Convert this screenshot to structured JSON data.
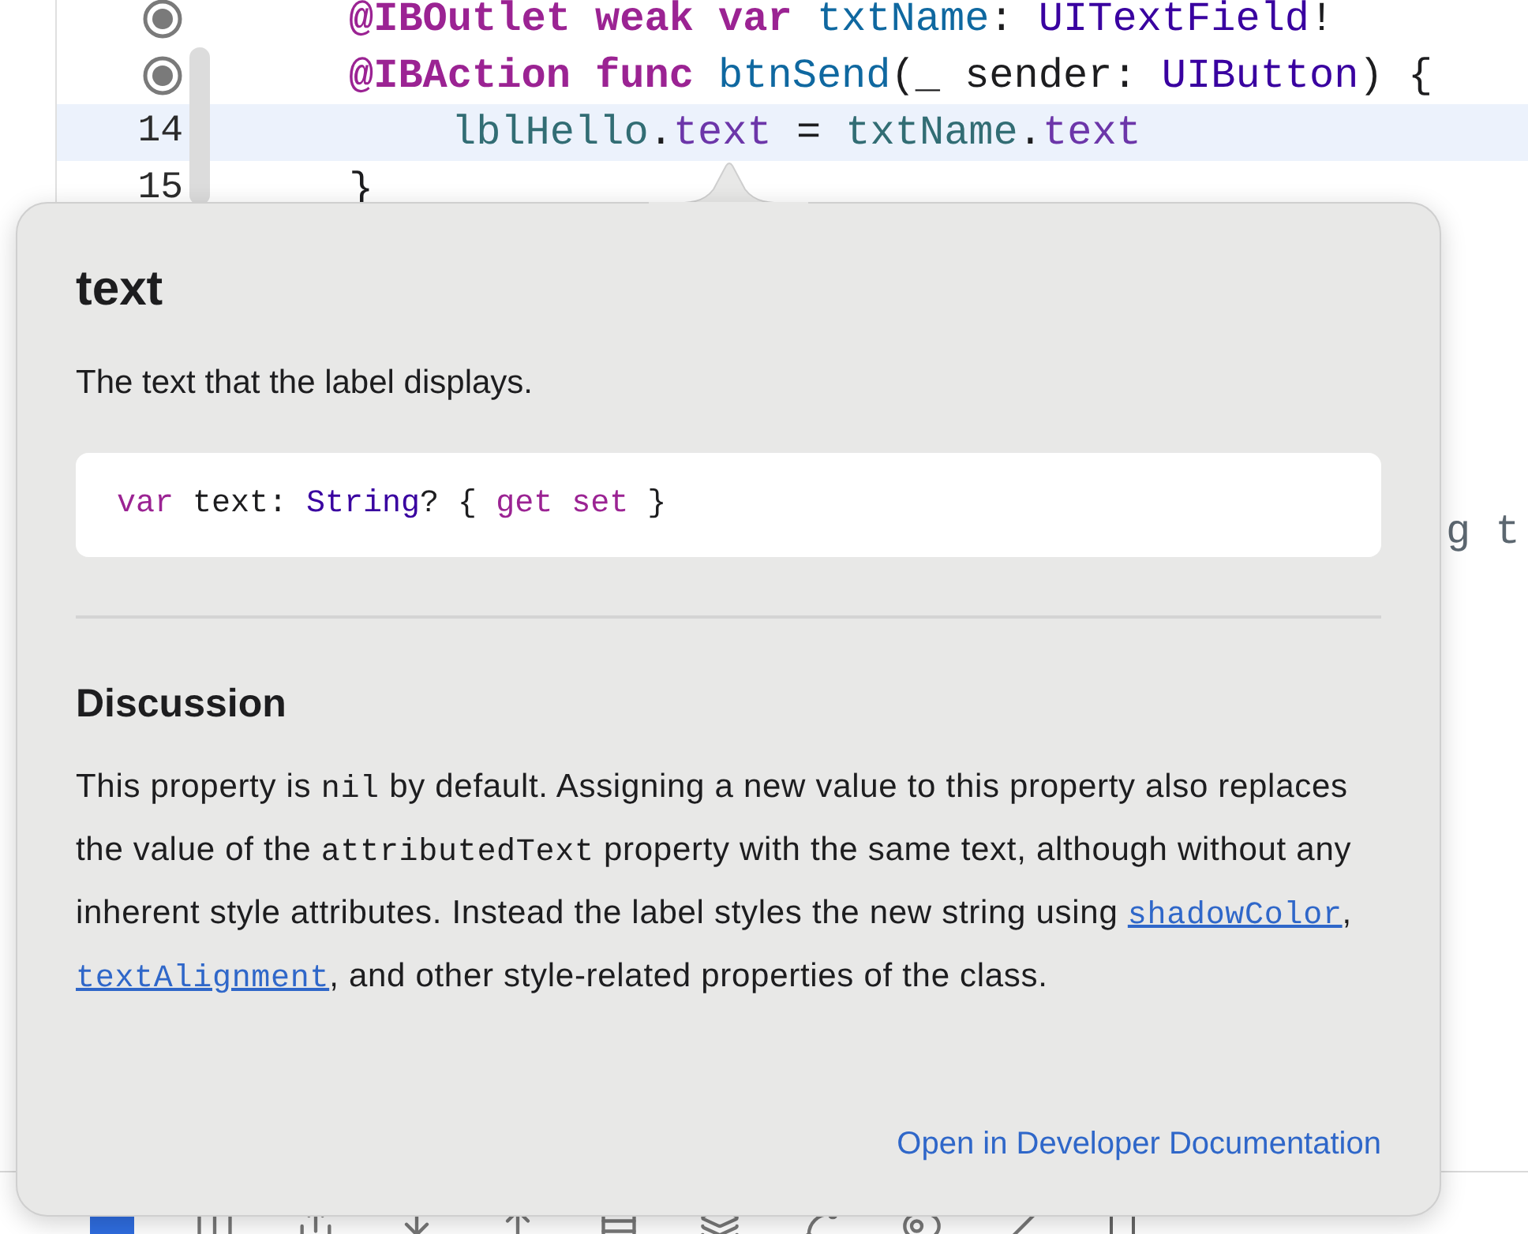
{
  "editor": {
    "lines": [
      {
        "breakpoint": true,
        "highlighted": false,
        "tokens": [
          {
            "kind": "keyword",
            "t": "@IBOutlet weak var "
          },
          {
            "kind": "decl",
            "t": "txtName"
          },
          {
            "kind": "plain",
            "t": ": "
          },
          {
            "kind": "type",
            "t": "UITextField"
          },
          {
            "kind": "plain",
            "t": "!"
          }
        ]
      },
      {
        "breakpoint": true,
        "highlighted": false,
        "tokens": [
          {
            "kind": "keyword",
            "t": "@IBAction func "
          },
          {
            "kind": "decl",
            "t": "btnSend"
          },
          {
            "kind": "plain",
            "t": "(_ sender: "
          },
          {
            "kind": "type",
            "t": "UIButton"
          },
          {
            "kind": "plain",
            "t": ") {"
          }
        ]
      },
      {
        "number": "14",
        "highlighted": true,
        "indent": true,
        "tokens": [
          {
            "kind": "ident",
            "t": "lblHello"
          },
          {
            "kind": "plain",
            "t": "."
          },
          {
            "kind": "property",
            "t": "text"
          },
          {
            "kind": "plain",
            "t": " = "
          },
          {
            "kind": "ident",
            "t": "txtName"
          },
          {
            "kind": "plain",
            "t": "."
          },
          {
            "kind": "property",
            "t": "text"
          }
        ]
      },
      {
        "number": "15",
        "highlighted": false,
        "tokens": [
          {
            "kind": "plain",
            "t": "}"
          }
        ]
      }
    ],
    "hidden_fragment": "g t"
  },
  "popover": {
    "title": "text",
    "summary": "The text that the label displays.",
    "declaration": [
      {
        "kind": "keyword",
        "t": "var"
      },
      {
        "kind": "plain",
        "t": " text: "
      },
      {
        "kind": "type",
        "t": "String"
      },
      {
        "kind": "plain",
        "t": "? { "
      },
      {
        "kind": "keyword",
        "t": "get set"
      },
      {
        "kind": "plain",
        "t": " }"
      }
    ],
    "section_title": "Discussion",
    "discussion": [
      {
        "kind": "text",
        "t": "This property is "
      },
      {
        "kind": "code",
        "t": "nil"
      },
      {
        "kind": "text",
        "t": " by default. Assigning a new value to this property also replaces the value of the "
      },
      {
        "kind": "code",
        "t": "attributedText"
      },
      {
        "kind": "text",
        "t": " property with the same text, although without any inherent style attributes. Instead the label styles the new string using "
      },
      {
        "kind": "link",
        "t": "shadowColor"
      },
      {
        "kind": "text",
        "t": ", "
      },
      {
        "kind": "link",
        "t": "textAlignment"
      },
      {
        "kind": "text",
        "t": ", and other style-related properties of the class."
      }
    ],
    "doc_link": "Open in Developer Documentation"
  },
  "toolbar": {
    "navigator_selected": true
  }
}
